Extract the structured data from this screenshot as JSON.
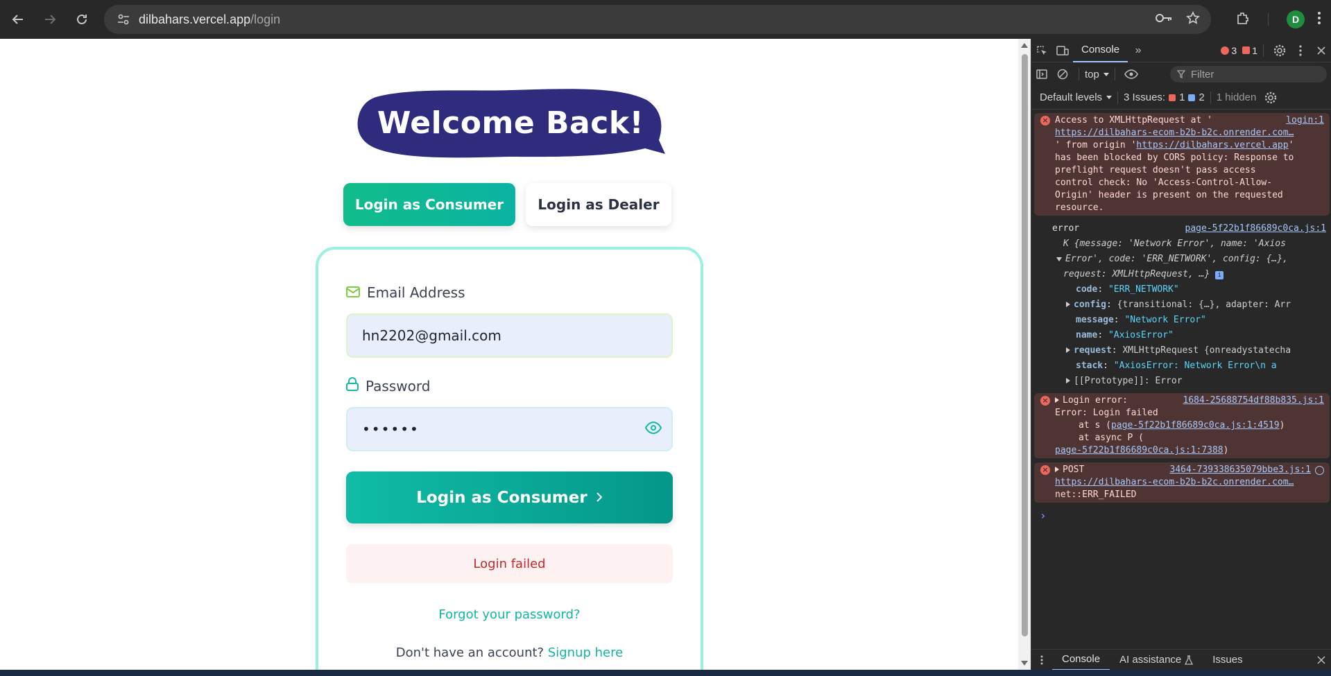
{
  "browser": {
    "url_host": "dilbahars.vercel.app",
    "url_path": "/login",
    "profile_initial": "D",
    "icons": [
      "back-icon",
      "forward-icon",
      "reload-icon",
      "site-info-icon",
      "password-key-icon",
      "bookmark-star-icon",
      "extensions-icon",
      "avatar",
      "menu-kebab-icon"
    ]
  },
  "page": {
    "welcome_title": "Welcome Back!",
    "role_tabs": {
      "consumer": "Login as Consumer",
      "dealer": "Login as Dealer"
    },
    "email": {
      "label": "Email Address",
      "value": "hn2202@gmail.com"
    },
    "password": {
      "label": "Password",
      "value": "••••••"
    },
    "submit_label": "Login as Consumer",
    "error_message": "Login failed",
    "forgot_link": "Forgot your password?",
    "signup_prompt": "Don't have an account?",
    "signup_link": "Signup here",
    "colors": {
      "accent_teal": "#0ab3a2",
      "bubble": "#2f2c7e",
      "error_text": "#c62828"
    }
  },
  "devtools": {
    "tab_label": "Console",
    "error_count": "3",
    "warning_count": "1",
    "context": "top",
    "filter_placeholder": "Filter",
    "levels": "Default levels",
    "issues_label": "3 Issues:",
    "issues_errors": "1",
    "issues_info": "2",
    "hidden": "1 hidden",
    "messages": {
      "cors": {
        "source": "login:1",
        "l1": "Access to XMLHttpRequest at '",
        "url": "https://dilbahars-ecom-b2b-b2c.onrender.com…",
        "l2a": "' from origin '",
        "origin": "https://dilbahars.vercel.app",
        "l2b": "'",
        "l3": "has been blocked by CORS policy: Response to",
        "l4": "preflight request doesn't pass access",
        "l5": "control check: No 'Access-Control-Allow-",
        "l6": "Origin' header is present on the requested",
        "l7": "resource."
      },
      "error_log": {
        "label": "error",
        "source": "page-5f22b1f86689c0ca.js:1",
        "k_line": "K {message: 'Network Error', name: 'Axios",
        "k_line2": "Error', code: 'ERR_NETWORK', config: {…},",
        "k_line3": "request: XMLHttpRequest, …}",
        "code_key": "code",
        "code_val": "\"ERR_NETWORK\"",
        "config_key": "config",
        "config_val": "{transitional: {…}, adapter: Arr",
        "message_key": "message",
        "message_val": "\"Network Error\"",
        "name_key": "name",
        "name_val": "\"AxiosError\"",
        "request_key": "request",
        "request_val": "XMLHttpRequest {onreadystatecha",
        "stack_key": "stack",
        "stack_val": "\"AxiosError: Network Error\\n    a",
        "proto": "[[Prototype]]: Error"
      },
      "login_error": {
        "label": "Login error:",
        "source": "1684-25688754df88b835.js:1",
        "l2": "Error: Login failed",
        "l3a": "at s (",
        "l3link": "page-5f22b1f86689c0ca.js:1:4519",
        "l3b": ")",
        "l4": "at async P (",
        "l5link": "page-5f22b1f86689c0ca.js:1:7388",
        "l5b": ")"
      },
      "post": {
        "label": "POST",
        "source": "3464-739338635079bbe3.js:1",
        "url": "https://dilbahars-ecom-b2b-b2c.onrender.com…",
        "status": "net::ERR_FAILED"
      }
    },
    "bottom_tabs": {
      "console": "Console",
      "ai": "AI assistance",
      "issues": "Issues"
    }
  }
}
